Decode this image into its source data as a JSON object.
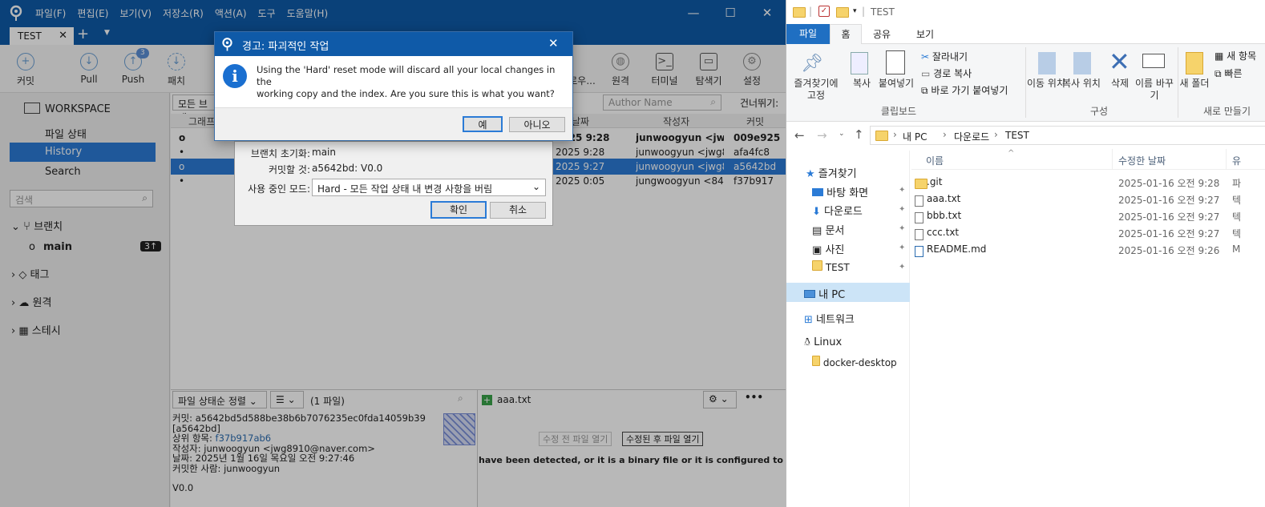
{
  "sourcetree": {
    "menu": [
      "파일(F)",
      "편집(E)",
      "보기(V)",
      "저장소(R)",
      "액션(A)",
      "도구",
      "도움말(H)"
    ],
    "tab": "TEST",
    "toolbar": [
      {
        "label": "커밋",
        "icon": "plus-circle-icon"
      },
      {
        "label": "Pull",
        "icon": "arrow-down-circle-icon"
      },
      {
        "label": "Push",
        "icon": "arrow-up-circle-icon",
        "badge": "3"
      },
      {
        "label": "패치",
        "icon": "fetch-icon"
      },
      {
        "label": "탐색기",
        "icon": "folder-icon"
      },
      {
        "label": "원격",
        "icon": "globe-icon"
      },
      {
        "label": "터미널",
        "icon": "terminal-icon"
      },
      {
        "label": "탐색기",
        "icon": "folder-icon"
      },
      {
        "label": "설정",
        "icon": "gear-icon"
      }
    ],
    "toolbar_partial": "로우...",
    "sidebar": {
      "workspace": "WORKSPACE",
      "items": [
        "파일 상태",
        "History",
        "Search"
      ],
      "search_placeholder": "검색",
      "branches": "브랜치",
      "branch_main": "main",
      "branch_badge": "3↑",
      "tags": "태그",
      "remotes": "원격",
      "stashes": "스테시"
    },
    "filter": {
      "branches": "모든 브랜",
      "author_placeholder": "Author Name",
      "skip": "건너뛰기:"
    },
    "columns": {
      "graph": "그래프",
      "date": "날짜",
      "author": "작성자",
      "commit": "커밋"
    },
    "commits": [
      {
        "date": "2025 9:28",
        "author": "junwoogyun <jwg8",
        "hash": "009e925",
        "bold": true
      },
      {
        "date": "2025 9:28",
        "author": "junwoogyun <jwg89",
        "hash": "afa4fc8",
        "bold": false
      },
      {
        "date": "2025 9:27",
        "author": "junwoogyun <jwg89",
        "hash": "a5642bd",
        "bold": false
      },
      {
        "date": "2025 0:05",
        "author": "jungwoogyun <8425",
        "hash": "f37b917",
        "bold": false
      }
    ],
    "bottom": {
      "sort": "파일 상태순 정렬",
      "count": "(1 파일)",
      "file": "aaa.txt",
      "detail": {
        "commit": "커밋: a5642bd5d588be38b6b7076235ec0fda14059b39",
        "short": "[a5642bd]",
        "parent_label": "상위 항목:",
        "parent": "f37b917ab6",
        "author": "작성자: junwoogyun <jwg8910@naver.com>",
        "date": "날짜: 2025년 1월 16일 목요일 오전 9:27:46",
        "committer": "커밋한 사람: junwoogyun",
        "message": "V0.0"
      },
      "open_before": "수정 전 파일 열기",
      "open_after": "수정된 후 파일 열기",
      "binary_msg": "have been detected, or it is a binary file or it is configured to be igno"
    },
    "reset_dialog": {
      "branch_label": "브랜치 초기화:",
      "branch_value": "main",
      "commit_label": "커밋할 것:",
      "commit_value": "a5642bd: V0.0",
      "mode_label": "사용 중인 모드:",
      "mode_value": "Hard - 모든 작업 상태 내 변경 사항을 버림",
      "ok": "확인",
      "cancel": "취소"
    },
    "warning": {
      "title": "경고: 파괴적인 작업",
      "message1": "Using the 'Hard' reset mode will discard all your local changes in the",
      "message2": "working copy and the index. Are you sure this is what you want?",
      "yes": "예",
      "no": "아니오"
    }
  },
  "explorer": {
    "title": "TEST",
    "tabs": [
      "파일",
      "홈",
      "공유",
      "보기"
    ],
    "ribbon": {
      "pin": "즐겨찾기에 고정",
      "copy": "복사",
      "paste": "붙여넣기",
      "cut": "잘라내기",
      "copy_path": "경로 복사",
      "paste_shortcut": "바로 가기 붙여넣기",
      "clipboard": "클립보드",
      "move_to": "이동 위치",
      "copy_to": "복사 위치",
      "delete": "삭제",
      "rename": "이름 바꾸기",
      "organize": "구성",
      "new_folder": "새 폴더",
      "new_item": "새 항목",
      "easy_access": "빠른",
      "new": "새로 만들기"
    },
    "breadcrumb": [
      "내 PC",
      "다운로드",
      "TEST"
    ],
    "nav": {
      "favorites": "즐겨찾기",
      "pinned": [
        "바탕 화면",
        "다운로드",
        "문서",
        "사진",
        "TEST"
      ],
      "mypc": "내 PC",
      "network": "네트워크",
      "linux": "Linux",
      "docker": "docker-desktop"
    },
    "headers": {
      "name": "이름",
      "modified": "수정한 날짜",
      "type": "유"
    },
    "files": [
      {
        "name": ".git",
        "date": "2025-01-16 오전 9:28",
        "type": "파",
        "folder": true
      },
      {
        "name": "aaa.txt",
        "date": "2025-01-16 오전 9:27",
        "type": "텍",
        "folder": false
      },
      {
        "name": "bbb.txt",
        "date": "2025-01-16 오전 9:27",
        "type": "텍",
        "folder": false
      },
      {
        "name": "ccc.txt",
        "date": "2025-01-16 오전 9:27",
        "type": "텍",
        "folder": false
      },
      {
        "name": "README.md",
        "date": "2025-01-16 오전 9:26",
        "type": "M",
        "folder": false
      }
    ]
  },
  "colors": {
    "titlebar": "#0f5aa8",
    "selection": "#2b7bd6",
    "folder": "#f6d36b"
  }
}
